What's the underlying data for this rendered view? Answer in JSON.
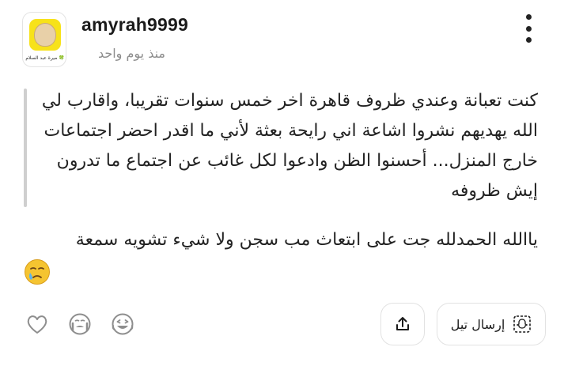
{
  "post": {
    "author": {
      "username": "amyrah9999",
      "avatar_caption": "ميرة عبد السلام 🍀"
    },
    "timestamp": "منذ يوم واحد",
    "quote": "كنت تعبانة وعندي ظروف قاهرة اخر خمس سنوات تقريبا، واقارب لي الله يهديهم نشروا اشاعة اني رايحة بعثة لأني ما اقدر احضر اجتماعات خارج المنزل... أحسنوا الظن وادعوا لكل غائب عن اجتماع ما تدرون إيش ظروفه",
    "body": "ياالله الحمدلله جت على ابتعاث مب سجن ولا شيء تشويه سمعة",
    "emoji": "crying-face"
  },
  "actions": {
    "like_icon": "heart-icon",
    "laugh_cry_icon": "crying-face-icon",
    "rofl_icon": "laughing-face-icon",
    "share_icon": "share-upload-icon",
    "snap_button_label": "إرسال تيل",
    "snap_icon": "ghost-frame-icon"
  },
  "colors": {
    "accent_yellow": "#f7e21a",
    "icon_gray": "#8e8e8e",
    "quote_bar": "#cfcfcf",
    "emoji_yellow": "#f5c431"
  }
}
